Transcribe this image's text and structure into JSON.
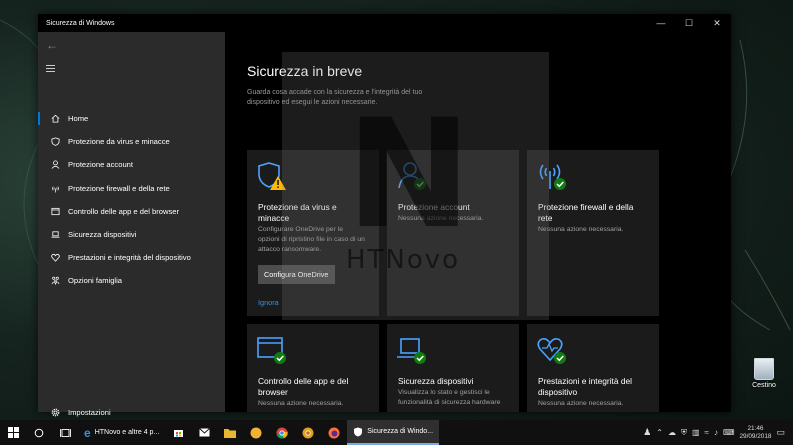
{
  "window": {
    "title": "Sicurezza di Windows"
  },
  "sidebar": {
    "items": [
      {
        "label": "Home",
        "icon": "home-icon"
      },
      {
        "label": "Protezione da virus e minacce",
        "icon": "shield-icon"
      },
      {
        "label": "Protezione account",
        "icon": "person-icon"
      },
      {
        "label": "Protezione firewall e della rete",
        "icon": "wifi-icon"
      },
      {
        "label": "Controllo delle app e del browser",
        "icon": "browser-icon"
      },
      {
        "label": "Sicurezza dispositivi",
        "icon": "laptop-icon"
      },
      {
        "label": "Prestazioni e integrità del dispositivo",
        "icon": "heart-icon"
      },
      {
        "label": "Opzioni famiglia",
        "icon": "family-icon"
      }
    ],
    "settings_label": "Impostazioni"
  },
  "main": {
    "title": "Sicurezza in breve",
    "subtitle": "Guarda cosa accade con la sicurezza e l'integrità del tuo dispositivo ed esegui le azioni necessarie.",
    "cards": [
      {
        "title": "Protezione da virus e minacce",
        "desc": "Configurare OneDrive per le opzioni di ripristino file in caso di un attacco ransomware.",
        "button": "Configura OneDrive",
        "link": "Ignora",
        "status": "warning"
      },
      {
        "title": "Protezione account",
        "desc": "Nessuna azione necessaria.",
        "status": "ok"
      },
      {
        "title": "Protezione firewall e della rete",
        "desc": "Nessuna azione necessaria.",
        "status": "ok"
      },
      {
        "title": "Controllo delle app e del browser",
        "desc": "Nessuna azione necessaria.",
        "status": "ok"
      },
      {
        "title": "Sicurezza dispositivi",
        "desc": "Visualizza lo stato e gestisci le funzionalità di sicurezza hardware",
        "status": "ok"
      },
      {
        "title": "Prestazioni e integrità del dispositivo",
        "desc": "Nessuna azione necessaria.",
        "status": "ok"
      }
    ]
  },
  "watermark": {
    "letter": "N",
    "text": "HTNovo"
  },
  "desktop": {
    "recycle_label": "Cestino"
  },
  "taskbar": {
    "apps": [
      {
        "label": "HTNovo e altre 4 p...",
        "active": false
      },
      {
        "label": "Sicurezza di Windo...",
        "active": true
      }
    ],
    "time": "21:46",
    "date": "29/09/2018"
  },
  "colors": {
    "accent": "#0078d7",
    "ok": "#107c10",
    "warning": "#ffb900",
    "icon_blue": "#4aa3ff"
  }
}
